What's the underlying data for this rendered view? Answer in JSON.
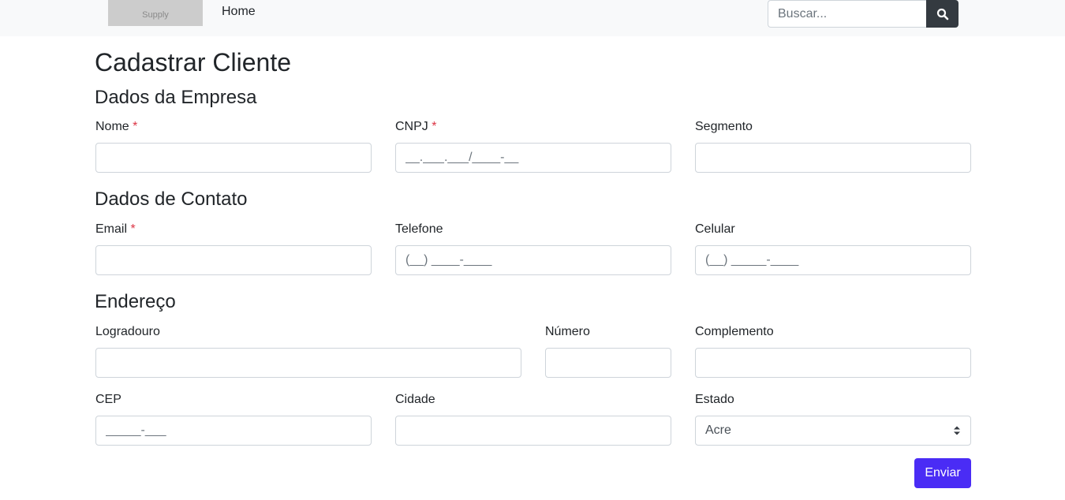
{
  "navbar": {
    "logo_text": "Supply",
    "home_label": "Home",
    "search_placeholder": "Buscar...",
    "search_icon": "search-icon"
  },
  "page_title": "Cadastrar Cliente",
  "sections": {
    "empresa": "Dados da Empresa",
    "contato": "Dados de Contato",
    "endereco": "Endereço"
  },
  "fields": {
    "nome": {
      "label": "Nome",
      "required_mark": "*",
      "value": "",
      "placeholder": ""
    },
    "cnpj": {
      "label": "CNPJ",
      "required_mark": "*",
      "value": "",
      "placeholder": "__.___.___/____-__"
    },
    "segmento": {
      "label": "Segmento",
      "value": "",
      "placeholder": ""
    },
    "email": {
      "label": "Email",
      "required_mark": "*",
      "value": "",
      "placeholder": ""
    },
    "telefone": {
      "label": "Telefone",
      "value": "",
      "placeholder": "(__) ____-____"
    },
    "celular": {
      "label": "Celular",
      "value": "",
      "placeholder": "(__) _____-____"
    },
    "logradouro": {
      "label": "Logradouro",
      "value": "",
      "placeholder": ""
    },
    "numero": {
      "label": "Número",
      "value": "",
      "placeholder": ""
    },
    "complemento": {
      "label": "Complemento",
      "value": "",
      "placeholder": ""
    },
    "cep": {
      "label": "CEP",
      "value": "",
      "placeholder": "_____-___"
    },
    "cidade": {
      "label": "Cidade",
      "value": "",
      "placeholder": ""
    },
    "estado": {
      "label": "Estado",
      "selected": "Acre"
    }
  },
  "submit_label": "Enviar",
  "colors": {
    "primary_button": "#4a2cf5",
    "search_button": "#343a40",
    "required": "#dc3545",
    "navbar_bg": "#f8f9fa"
  }
}
